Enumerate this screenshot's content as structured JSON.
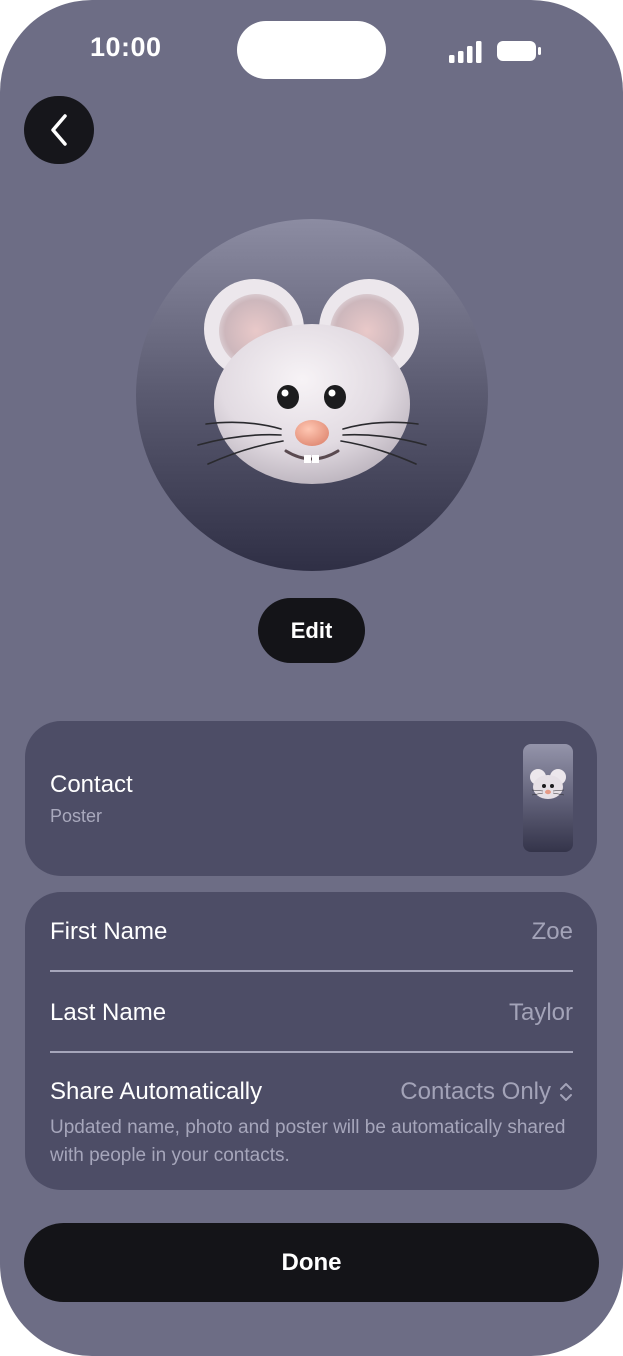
{
  "status_bar": {
    "time": "10:00",
    "icons": [
      "cellular-signal-icon",
      "battery-icon"
    ]
  },
  "nav": {
    "back_icon": "chevron-left-icon"
  },
  "avatar": {
    "image": "mouse-memoji",
    "edit_label": "Edit"
  },
  "poster": {
    "title": "Contact",
    "subtitle": "Poster"
  },
  "fields": {
    "first_name_label": "First Name",
    "first_name_value": "Zoe",
    "last_name_label": "Last Name",
    "last_name_value": "Taylor",
    "share_label": "Share Automatically",
    "share_value": "Contacts Only",
    "share_description": "Updated name, photo and poster will be automatically shared with people in your contacts."
  },
  "actions": {
    "done_label": "Done"
  },
  "colors": {
    "background": "#6d6d85",
    "card": "#4d4d66",
    "button_dark": "#141418"
  }
}
